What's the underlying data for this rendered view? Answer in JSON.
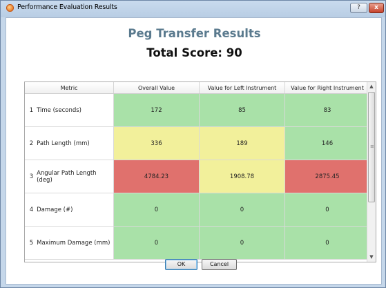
{
  "window": {
    "title": "Performance Evaluation Results",
    "help_label": "?",
    "close_label": "x"
  },
  "header": {
    "title": "Peg Transfer Results",
    "score": "Total Score: 90"
  },
  "table": {
    "columns": [
      "Metric",
      "Overall Value",
      "Value for Left Instrument",
      "Value for Right Instrument"
    ],
    "rows": [
      {
        "index": "1",
        "metric": "Time (seconds)",
        "overall": "172",
        "left": "85",
        "right": "83"
      },
      {
        "index": "2",
        "metric": "Path Length (mm)",
        "overall": "336",
        "left": "189",
        "right": "146"
      },
      {
        "index": "3",
        "metric": "Angular Path Length (deg)",
        "overall": "4784.23",
        "left": "1908.78",
        "right": "2875.45"
      },
      {
        "index": "4",
        "metric": "Damage (#)",
        "overall": "0",
        "left": "0",
        "right": "0"
      },
      {
        "index": "5",
        "metric": "Maximum Damage (mm)",
        "overall": "0",
        "left": "0",
        "right": "0"
      }
    ],
    "cell_colors": {
      "green": "#a9e1a8",
      "yellow": "#f2f09b",
      "red": "#e0716d"
    }
  },
  "buttons": {
    "ok": "OK",
    "cancel": "Cancel"
  }
}
